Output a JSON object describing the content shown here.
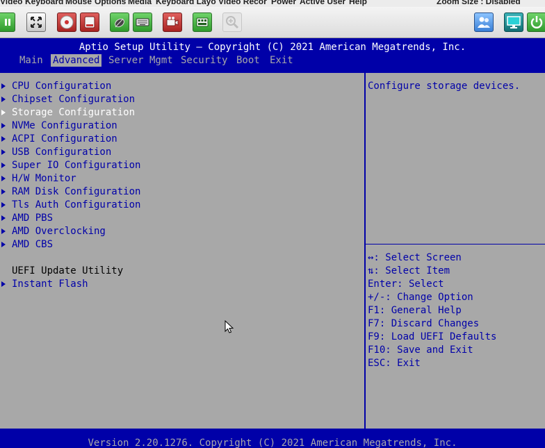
{
  "viewer": {
    "menu": [
      "Video",
      "Keyboard",
      "Mouse",
      "Options",
      "Media",
      "Keyboard Layo",
      "Video Recor",
      "Power",
      "Active User",
      "Help"
    ],
    "zoom_status": "Zoom Size : Disabled"
  },
  "toolbar": {
    "buttons": [
      "pause-icon",
      "fullscreen-icon",
      "cd-media-icon",
      "disk-media-icon",
      "mouse-icon",
      "keyboard-icon",
      "video-record-icon",
      "macro-icon",
      "zoom-icon",
      "user-icon",
      "display-icon",
      "power-icon"
    ]
  },
  "bios": {
    "title": "Aptio Setup Utility – Copyright (C) 2021 American Megatrends, Inc.",
    "tabs": [
      "Main",
      "Advanced",
      "Server Mgmt",
      "Security",
      "Boot",
      "Exit"
    ],
    "active_tab": "Advanced",
    "menu_items": [
      "CPU Configuration",
      "Chipset Configuration",
      "Storage Configuration",
      "NVMe Configuration",
      "ACPI Configuration",
      "USB Configuration",
      "Super IO Configuration",
      "H/W Monitor",
      "RAM Disk Configuration",
      "Tls Auth Configuration",
      "AMD PBS",
      "AMD Overclocking",
      "AMD CBS"
    ],
    "selected_item": "Storage Configuration",
    "section_label": "UEFI Update Utility",
    "section_items": [
      "Instant Flash"
    ],
    "help_text": "Configure storage devices.",
    "key_help": [
      "↔: Select Screen",
      "⇅: Select Item",
      "Enter: Select",
      "+/-: Change Option",
      "F1: General Help",
      "F7: Discard Changes",
      "F9: Load UEFI Defaults",
      "F10: Save and Exit",
      "ESC: Exit"
    ],
    "footer": "Version 2.20.1276. Copyright (C) 2021 American Megatrends, Inc.",
    "colors": {
      "blue": "#0000a8",
      "gray": "#a8a8a8",
      "white": "#ffffff"
    }
  }
}
